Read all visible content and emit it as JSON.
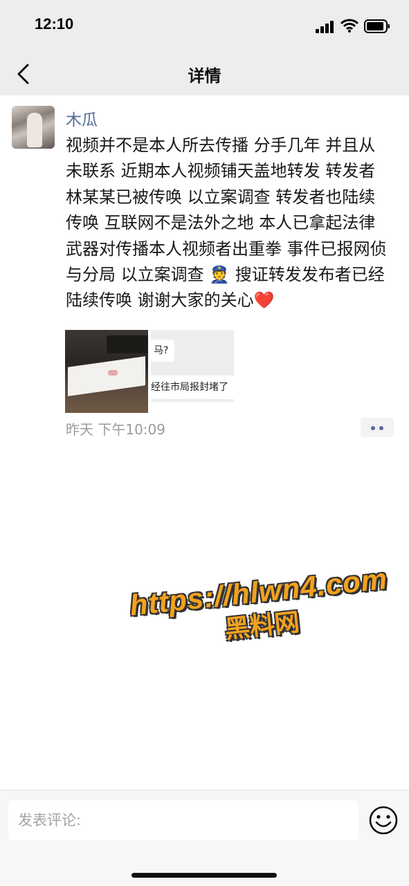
{
  "status_bar": {
    "time": "12:10"
  },
  "nav": {
    "title": "详情"
  },
  "post": {
    "username": "木瓜",
    "text": "视频并不是本人所去传播 分手几年 并且从未联系 近期本人视频铺天盖地转发 转发者林某某已被传唤 以立案调查 转发者也陆续传唤 互联网不是法外之地 本人已拿起法律武器对传播本人视频者出重拳 事件已报网侦与分局 以立案调查 👮 搜证转发发布者已经陆续传唤 谢谢大家的关心",
    "heart": "❤️",
    "image2_bubble1": "马?",
    "image2_bubble2": "经往市局报封堵了",
    "time": "昨天 下午10:09"
  },
  "watermark": {
    "url": "https://hlwn4.com",
    "name": "黑料网"
  },
  "comment": {
    "placeholder": "发表评论:"
  },
  "icons": {
    "back": "chevron-left-icon",
    "more": "more-dots-icon",
    "emoji": "smiley-face-icon",
    "signal": "signal-icon",
    "wifi": "wifi-icon",
    "battery": "battery-icon"
  },
  "colors": {
    "link_blue": "#576b95",
    "watermark_orange": "#f4a21e",
    "bar_gray": "#ededed"
  }
}
